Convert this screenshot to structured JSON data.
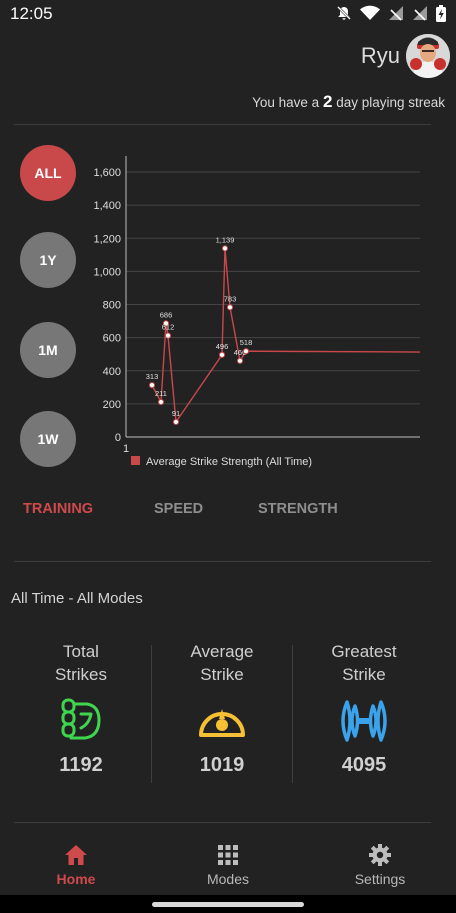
{
  "status": {
    "time": "12:05"
  },
  "header": {
    "user_name": "Ryu",
    "streak_prefix": "You have a",
    "streak_days": "2",
    "streak_suffix": "day playing streak"
  },
  "ranges": [
    "ALL",
    "1Y",
    "1M",
    "1W"
  ],
  "chart_data": {
    "type": "line",
    "x": [
      1,
      2,
      3,
      4,
      5,
      6,
      7,
      8,
      9,
      10,
      11
    ],
    "series": [
      {
        "name": "Average Strike Strength (All Time)",
        "values": [
          313,
          211,
          686,
          612,
          91,
          496,
          1139,
          783,
          460,
          518,
          513
        ]
      }
    ],
    "point_labels": [
      "313",
      "211",
      "686",
      "612",
      "91",
      "496",
      "1,139",
      "783",
      "460",
      "518",
      ""
    ],
    "y_ticks": [
      "0",
      "200",
      "400",
      "600",
      "800",
      "1,000",
      "1,200",
      "1,400",
      "1,600"
    ],
    "x_ticks": [
      "1"
    ],
    "ylim": [
      0,
      1600
    ],
    "grid": true,
    "legend": "bottom",
    "line_color": "#c9484a"
  },
  "tabs": [
    "TRAINING",
    "SPEED",
    "STRENGTH"
  ],
  "section_title": "All Time - All Modes",
  "stats": [
    {
      "label_line1": "Total",
      "label_line2": "Strikes",
      "value": "1192",
      "icon": "fist-icon",
      "color": "#3ed64f"
    },
    {
      "label_line1": "Average",
      "label_line2": "Strike",
      "value": "1019",
      "icon": "gauge-icon",
      "color": "#f5c033"
    },
    {
      "label_line1": "Greatest",
      "label_line2": "Strike",
      "value": "4095",
      "icon": "dumbbell-icon",
      "color": "#3aa3ec"
    }
  ],
  "nav": [
    {
      "label": "Home",
      "icon": "home-icon"
    },
    {
      "label": "Modes",
      "icon": "grid-icon"
    },
    {
      "label": "Settings",
      "icon": "gear-icon"
    }
  ],
  "colors": {
    "accent": "#c9484a",
    "inactive": "#777777",
    "background": "#222222"
  }
}
